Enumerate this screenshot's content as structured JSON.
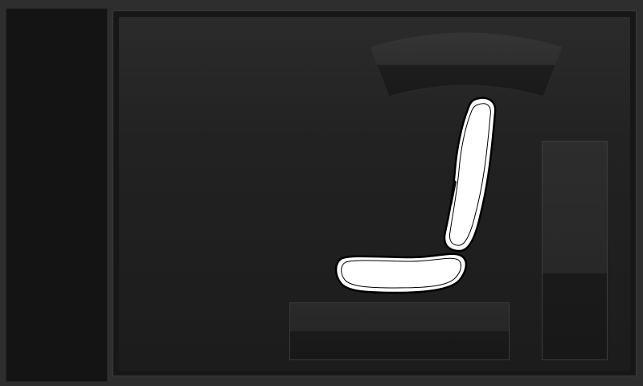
{
  "window": {
    "title": ""
  },
  "colors": {
    "background": "#2e2e2e",
    "sidebar": "#141414",
    "panel": "#1c1c1c",
    "seat_fill": "#ffffff",
    "seat_outline": "#000000",
    "control_dark": "#181818",
    "control_light": "#2a2a2a"
  },
  "icons": {
    "headrest": "headrest-adjust-icon",
    "seat": "car-seat-icon"
  },
  "controls": {
    "headrest_adjust": {
      "name": "headrest-adjust-button"
    },
    "seat_base": {
      "name": "seat-base-adjust-button"
    },
    "side_column": {
      "name": "seat-height-adjust-button"
    }
  }
}
